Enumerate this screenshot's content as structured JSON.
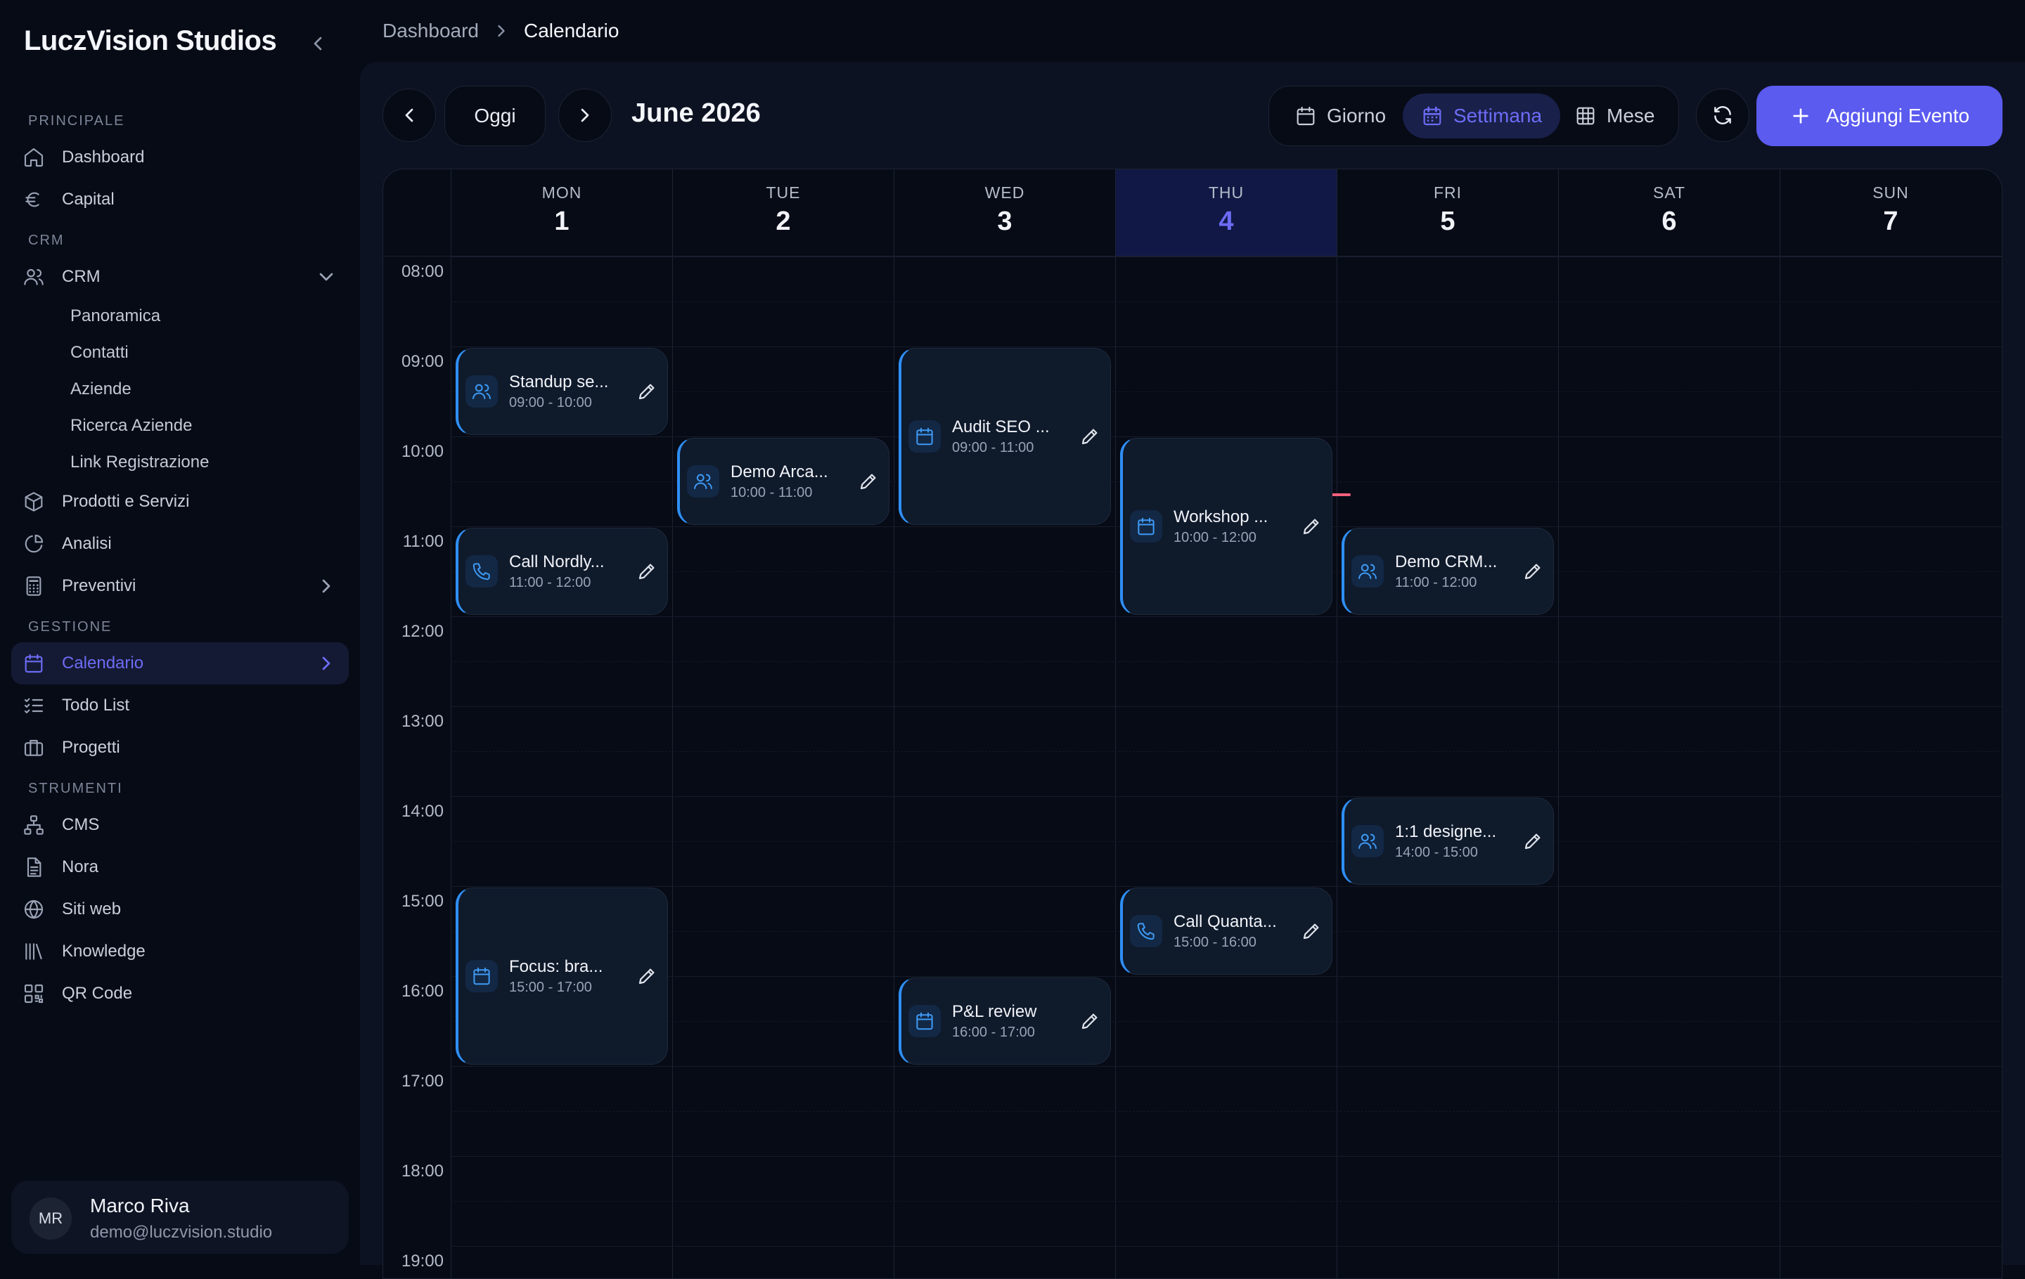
{
  "brand": "LuczVision Studios",
  "sidebar": {
    "sections": {
      "principale": "PRINCIPALE",
      "crm": "CRM",
      "gestione": "GESTIONE",
      "strumenti": "STRUMENTI"
    },
    "items": {
      "dashboard": "Dashboard",
      "capital": "Capital",
      "crm": "CRM",
      "prodotti": "Prodotti e Servizi",
      "analisi": "Analisi",
      "preventivi": "Preventivi",
      "calendario": "Calendario",
      "todo": "Todo List",
      "progetti": "Progetti",
      "cms": "CMS",
      "nora": "Nora",
      "siti": "Siti web",
      "knowledge": "Knowledge",
      "qr": "QR Code"
    },
    "crm_sub": [
      "Panoramica",
      "Contatti",
      "Aziende",
      "Ricerca Aziende",
      "Link Registrazione"
    ]
  },
  "user": {
    "initials": "MR",
    "name": "Marco Riva",
    "email": "demo@luczvision.studio"
  },
  "breadcrumb": [
    "Dashboard",
    "Calendario"
  ],
  "toolbar": {
    "today": "Oggi",
    "month_title": "June 2026",
    "views": [
      "Giorno",
      "Settimana",
      "Mese"
    ],
    "active_view": "Settimana",
    "add_event": "Aggiungi Evento"
  },
  "calendar": {
    "days": [
      {
        "dow": "MON",
        "num": "1"
      },
      {
        "dow": "TUE",
        "num": "2"
      },
      {
        "dow": "WED",
        "num": "3"
      },
      {
        "dow": "THU",
        "num": "4",
        "today": true
      },
      {
        "dow": "FRI",
        "num": "5"
      },
      {
        "dow": "SAT",
        "num": "6"
      },
      {
        "dow": "SUN",
        "num": "7"
      }
    ],
    "hours": [
      "08:00",
      "09:00",
      "10:00",
      "11:00",
      "12:00",
      "13:00",
      "14:00",
      "15:00",
      "16:00",
      "17:00",
      "18:00",
      "19:00"
    ],
    "events": [
      {
        "title": "Standup se...",
        "time": "09:00 - 10:00",
        "icon": "users-icon"
      },
      {
        "title": "Call Nordly...",
        "time": "11:00 - 12:00",
        "icon": "phone-icon"
      },
      {
        "title": "Focus: bra...",
        "time": "15:00 - 17:00",
        "icon": "calendar-icon"
      },
      {
        "title": "Demo Arca...",
        "time": "10:00 - 11:00",
        "icon": "users-icon"
      },
      {
        "title": "Audit SEO ...",
        "time": "09:00 - 11:00",
        "icon": "calendar-icon"
      },
      {
        "title": "P&L review",
        "time": "16:00 - 17:00",
        "icon": "calendar-icon"
      },
      {
        "title": "Workshop ...",
        "time": "10:00 - 12:00",
        "icon": "calendar-icon"
      },
      {
        "title": "Call Quanta...",
        "time": "15:00 - 16:00",
        "icon": "phone-icon"
      },
      {
        "title": "Demo CRM...",
        "time": "11:00 - 12:00",
        "icon": "users-icon"
      },
      {
        "title": "1:1 designe...",
        "time": "14:00 - 15:00",
        "icon": "users-icon"
      }
    ]
  },
  "colors": {
    "accent": "#5b5bf0",
    "event_border": "#2f8ff5",
    "now_indicator": "#f0607a"
  }
}
